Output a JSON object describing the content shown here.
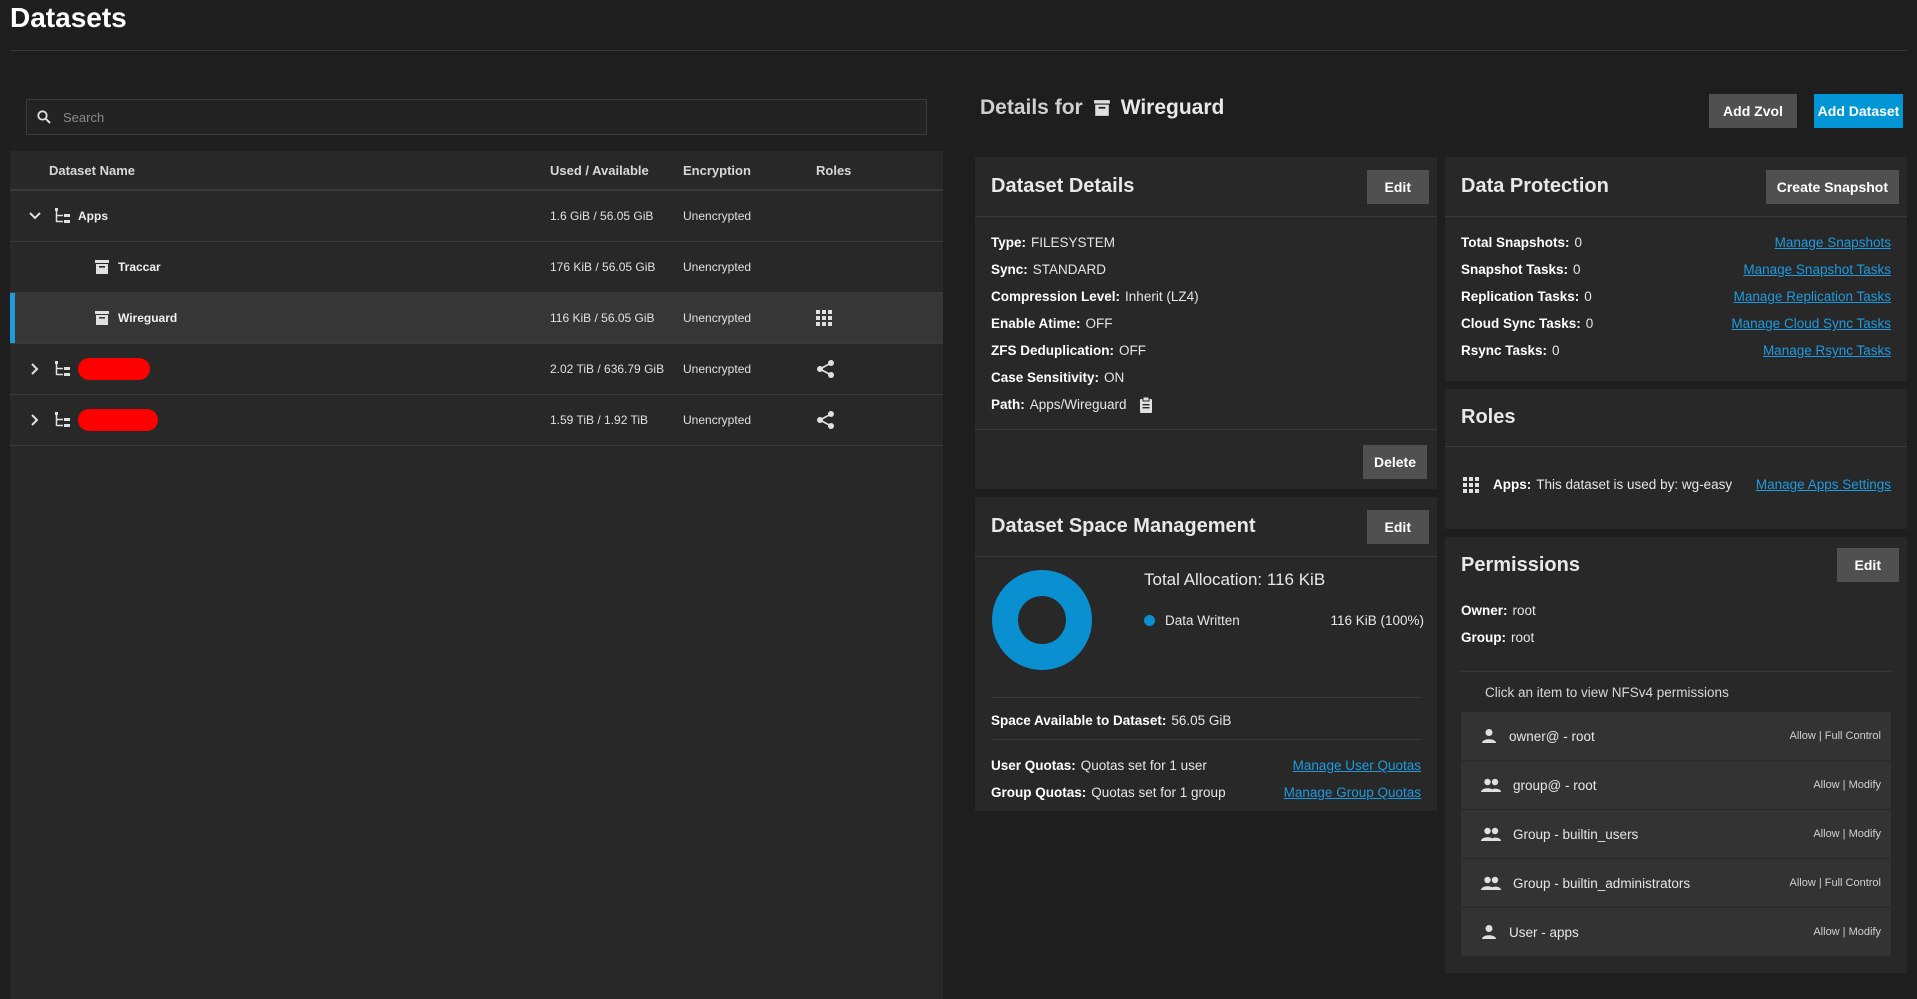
{
  "page": {
    "title": "Datasets"
  },
  "search": {
    "placeholder": "Search"
  },
  "tree": {
    "headers": {
      "name": "Dataset Name",
      "used": "Used / Available",
      "encryption": "Encryption",
      "roles": "Roles"
    },
    "rows": [
      {
        "name": "Apps",
        "used": "1.6 GiB / 56.05 GiB",
        "encryption": "Unencrypted"
      },
      {
        "name": "Traccar",
        "used": "176 KiB / 56.05 GiB",
        "encryption": "Unencrypted"
      },
      {
        "name": "Wireguard",
        "used": "116 KiB / 56.05 GiB",
        "encryption": "Unencrypted"
      },
      {
        "name": "",
        "used": "2.02 TiB / 636.79 GiB",
        "encryption": "Unencrypted"
      },
      {
        "name": "",
        "used": "1.59 TiB / 1.92 TiB",
        "encryption": "Unencrypted"
      }
    ]
  },
  "details": {
    "prefix": "Details for",
    "dataset": "Wireguard"
  },
  "actions": {
    "add_zvol": "Add Zvol",
    "add_dataset": "Add Dataset"
  },
  "dataset_details": {
    "title": "Dataset Details",
    "edit": "Edit",
    "delete": "Delete",
    "items": [
      {
        "label": "Type:",
        "value": "FILESYSTEM"
      },
      {
        "label": "Sync:",
        "value": "STANDARD"
      },
      {
        "label": "Compression Level:",
        "value": "Inherit (LZ4)"
      },
      {
        "label": "Enable Atime:",
        "value": "OFF"
      },
      {
        "label": "ZFS Deduplication:",
        "value": "OFF"
      },
      {
        "label": "Case Sensitivity:",
        "value": "ON"
      },
      {
        "label": "Path:",
        "value": "Apps/Wireguard"
      }
    ]
  },
  "space": {
    "title": "Dataset Space Management",
    "edit": "Edit",
    "total_label": "Total Allocation:",
    "total_value": "116 KiB",
    "legend_label": "Data Written",
    "legend_value": "116 KiB (100%)",
    "available_label": "Space Available to Dataset:",
    "available_value": "56.05 GiB",
    "user_quota_label": "User Quotas:",
    "user_quota_value": "Quotas set for 1 user",
    "user_quota_link": "Manage User Quotas",
    "group_quota_label": "Group Quotas:",
    "group_quota_value": "Quotas set for 1 group",
    "group_quota_link": "Manage Group Quotas",
    "accent": "#0a8fd0"
  },
  "protection": {
    "title": "Data Protection",
    "create": "Create Snapshot",
    "items": [
      {
        "label": "Total Snapshots:",
        "value": "0",
        "link": "Manage Snapshots"
      },
      {
        "label": "Snapshot Tasks:",
        "value": "0",
        "link": "Manage Snapshot Tasks"
      },
      {
        "label": "Replication Tasks:",
        "value": "0",
        "link": "Manage Replication Tasks"
      },
      {
        "label": "Cloud Sync Tasks:",
        "value": "0",
        "link": "Manage Cloud Sync Tasks"
      },
      {
        "label": "Rsync Tasks:",
        "value": "0",
        "link": "Manage Rsync Tasks"
      }
    ]
  },
  "roles": {
    "title": "Roles",
    "label": "Apps:",
    "value": "This dataset is used by: wg-easy",
    "link": "Manage Apps Settings"
  },
  "permissions": {
    "title": "Permissions",
    "edit": "Edit",
    "owner_label": "Owner:",
    "owner_value": "root",
    "group_label": "Group:",
    "group_value": "root",
    "hint": "Click an item to view NFSv4 permissions",
    "items": [
      {
        "name": "owner@ - root",
        "perm": "Allow | Full Control",
        "icon": "person-icon"
      },
      {
        "name": "group@ - root",
        "perm": "Allow | Modify",
        "icon": "group-icon"
      },
      {
        "name": "Group - builtin_users",
        "perm": "Allow | Modify",
        "icon": "group-icon"
      },
      {
        "name": "Group - builtin_administrators",
        "perm": "Allow | Full Control",
        "icon": "group-icon"
      },
      {
        "name": "User - apps",
        "perm": "Allow | Modify",
        "icon": "person-icon"
      }
    ]
  }
}
